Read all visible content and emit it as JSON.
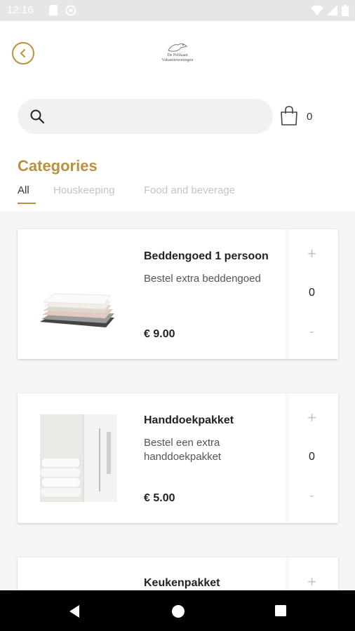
{
  "status_bar": {
    "time": "12:16"
  },
  "header": {
    "logo_text_line1": "De Pelikaan",
    "logo_text_line2": "Vakantiewoningen"
  },
  "search": {
    "placeholder": ""
  },
  "cart": {
    "count": "0"
  },
  "categories": {
    "title": "Categories",
    "tabs": [
      {
        "label": "All",
        "active": true
      },
      {
        "label": "Houskeeping",
        "active": false
      },
      {
        "label": "Food and beverage",
        "active": false
      }
    ]
  },
  "products": [
    {
      "name": "Beddengoed 1 persoon",
      "description": "Bestel extra beddengoed",
      "price": "€ 9.00",
      "quantity": "0",
      "plus": "+",
      "minus": "-"
    },
    {
      "name": "Handdoekpakket",
      "description": "Bestel een extra handdoekpakket",
      "price": "€ 5.00",
      "quantity": "0",
      "plus": "+",
      "minus": "-"
    },
    {
      "name": "Keukenpakket",
      "description": "",
      "price": "",
      "quantity": "",
      "plus": "+",
      "minus": ""
    }
  ],
  "colors": {
    "accent": "#b8923f",
    "background": "#f5f5f5"
  }
}
